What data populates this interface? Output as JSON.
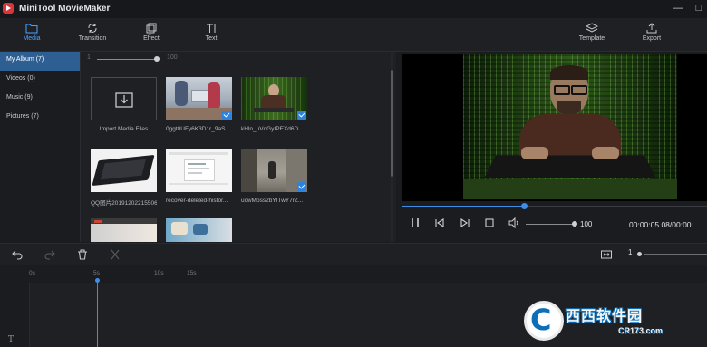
{
  "app": {
    "title": "MiniTool MovieMaker",
    "minimize": "—",
    "maximize": "□"
  },
  "toolbar": {
    "media": "Media",
    "transition": "Transition",
    "effect": "Effect",
    "text": "Text",
    "template": "Template",
    "export": "Export",
    "accent": "#4aa3ff"
  },
  "sidebar": {
    "items": [
      {
        "label": "My Album",
        "count": "(7)"
      },
      {
        "label": "Videos",
        "count": "(0)"
      },
      {
        "label": "Music",
        "count": "(9)"
      },
      {
        "label": "Pictures",
        "count": "(7)"
      }
    ]
  },
  "library": {
    "zoom_min": "1",
    "zoom_max": "100",
    "items": [
      {
        "label": "Import Media Files",
        "icon": "download-icon",
        "checked": false
      },
      {
        "label": "0ggt0UFy6K3D1r_9aS...",
        "checked": true
      },
      {
        "label": "kHln_uVqGyIPEXd6D...",
        "checked": true
      },
      {
        "label": "QQ图片20191202215506",
        "checked": false
      },
      {
        "label": "recover-deleted-histor...",
        "checked": false
      },
      {
        "label": "ucwMpss2bYITwY7rZ...",
        "checked": true
      }
    ]
  },
  "player": {
    "progress": 0.4,
    "volume": "100",
    "timecode": "00:00:05.08/00:00:"
  },
  "timeline": {
    "zoom_value": "1",
    "ticks": [
      "0s",
      "5s",
      "10s",
      "15s"
    ]
  },
  "watermark": {
    "text": "西西软件园",
    "sub": "CR173.com"
  }
}
